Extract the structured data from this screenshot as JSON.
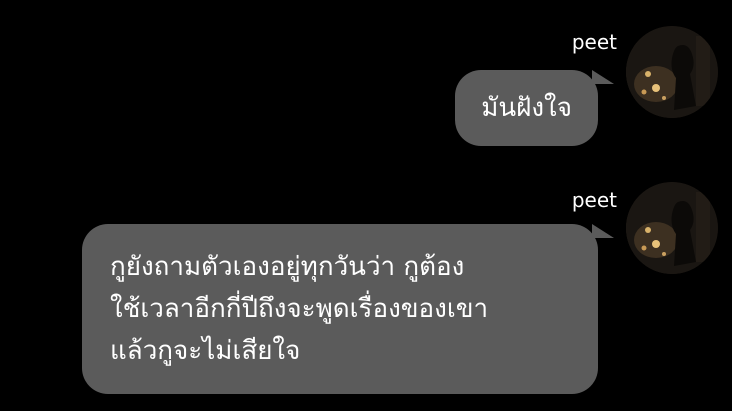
{
  "messages": [
    {
      "sender": "peet",
      "text": "มันฝังใจ"
    },
    {
      "sender": "peet",
      "text": "กูยังถามตัวเองอยู่ทุกวันว่า กูต้อง\nใช้เวลาอีกกี่ปีถึงจะพูดเรื่องของเขา\nแล้วกูจะไม่เสียใจ"
    }
  ],
  "colors": {
    "background": "#000000",
    "bubble": "#5b5b5b",
    "text": "#ffffff"
  }
}
